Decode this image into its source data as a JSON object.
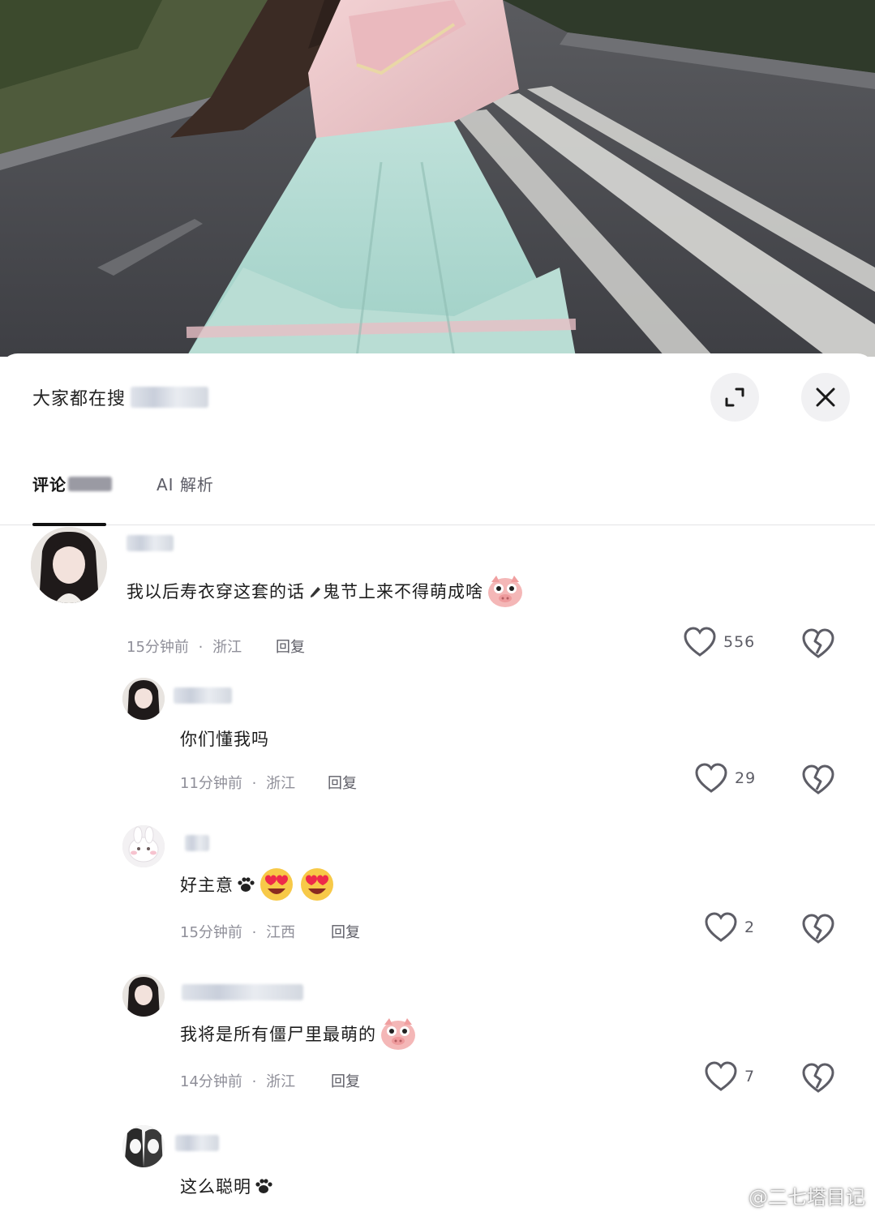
{
  "search_hint": {
    "label": "大家都在搜"
  },
  "header_buttons": {
    "expand_icon": "expand-icon",
    "close_icon": "close-icon"
  },
  "tabs": [
    {
      "label": "评论"
    },
    {
      "label": "AI 解析"
    }
  ],
  "comments": [
    {
      "text": "我以后寿衣穿这套的话",
      "text_after": "鬼节上来不得萌成啥",
      "time": "15分钟前",
      "location": "浙江",
      "reply_label": "回复",
      "likes": "556",
      "emoji": [
        "pig-face"
      ]
    },
    {
      "text": "你们懂我吗",
      "time": "11分钟前",
      "location": "浙江",
      "reply_label": "回复",
      "likes": "29"
    },
    {
      "text": "好主意",
      "time": "15分钟前",
      "location": "江西",
      "reply_label": "回复",
      "likes": "2",
      "emoji": [
        "paw",
        "heart-eyes",
        "heart-eyes"
      ]
    },
    {
      "text": "我将是所有僵尸里最萌的",
      "time": "14分钟前",
      "location": "浙江",
      "reply_label": "回复",
      "likes": "7",
      "emoji": [
        "pig-face"
      ]
    },
    {
      "text": "这么聪明",
      "emoji": [
        "paw"
      ]
    }
  ],
  "meta_separator": "·",
  "watermark": {
    "text": "@二七塔目记"
  },
  "colors": {
    "text_primary": "#1c1c1c",
    "text_meta": "#8f8f99",
    "icon_gray": "#5d5d66",
    "button_bg": "#f1f1f3"
  }
}
